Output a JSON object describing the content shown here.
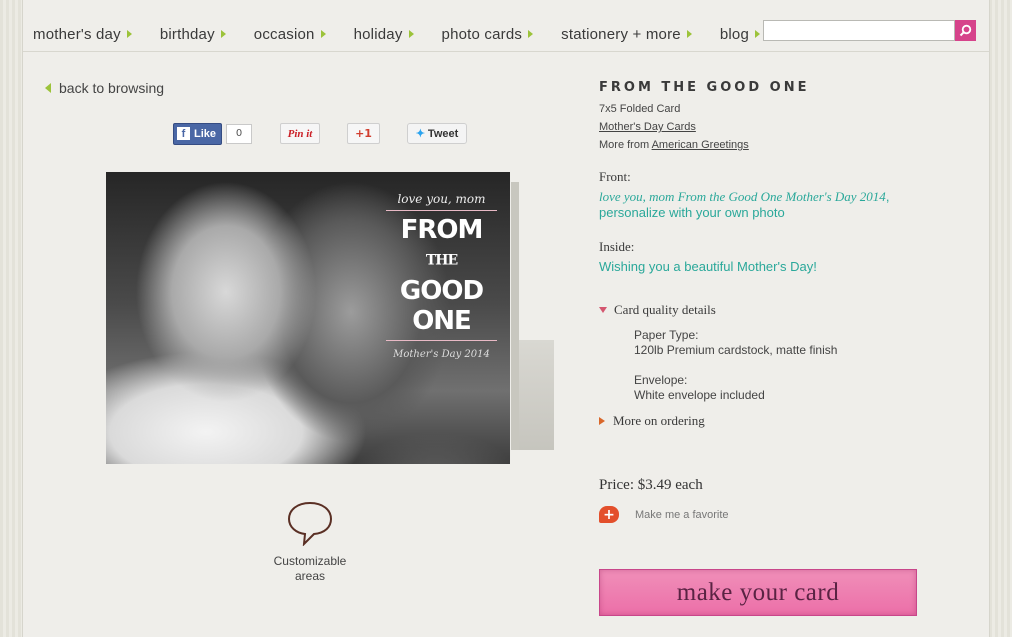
{
  "nav": {
    "items": [
      {
        "label": "mother's day"
      },
      {
        "label": "birthday"
      },
      {
        "label": "occasion"
      },
      {
        "label": "holiday"
      },
      {
        "label": "photo cards"
      },
      {
        "label": "stationery + more"
      },
      {
        "label": "blog"
      }
    ],
    "search_value": ""
  },
  "back": {
    "label": "back to browsing"
  },
  "social": {
    "facebook_label": "Like",
    "facebook_count": "0",
    "pinterest_label": "Pin it",
    "gplus_label": "+1",
    "tweet_label": "Tweet"
  },
  "card_image": {
    "script_top": "love you, mom",
    "line1": "FROM",
    "line1_small": "THE",
    "line2": "GOOD ONE",
    "script_bottom": "Mother's Day 2014"
  },
  "customize": {
    "label": "Customizable areas"
  },
  "product": {
    "title": "FROM THE GOOD ONE",
    "format": "7x5 Folded Card",
    "category_link": "Mother's Day Cards",
    "more_from_prefix": "More from",
    "more_from_link": "American Greetings",
    "front_label": "Front:",
    "front_text_italic": "love you, mom From the Good One Mother's Day 2014",
    "front_text_rest": ", personalize with your own photo",
    "inside_label": "Inside:",
    "inside_text": "Wishing you a beautiful Mother's Day!",
    "quality_toggle": "Card quality details",
    "paper_type_label": "Paper Type:",
    "paper_type_value": "120lb Premium cardstock, matte finish",
    "envelope_label": "Envelope:",
    "envelope_value": "White envelope included",
    "ordering_toggle": "More on ordering",
    "price": "Price: $3.49 each",
    "favorite_label": "Make me a favorite",
    "cta_label": "make your card"
  },
  "colors": {
    "accent_pink": "#ec6fa8",
    "nav_arrow_green": "#9cc33a",
    "teal_text": "#2aa89a",
    "search_button": "#d6438b"
  }
}
